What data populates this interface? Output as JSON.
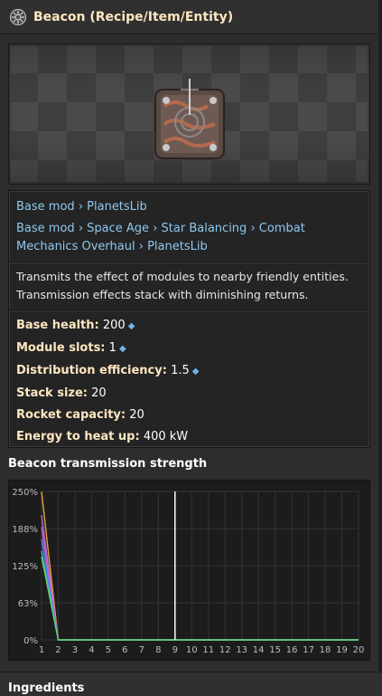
{
  "header": {
    "title": "Beacon (Recipe/Item/Entity)",
    "icon": "gear-icon"
  },
  "breadcrumbs": {
    "line1": [
      "Base mod",
      "PlanetsLib"
    ],
    "line2": [
      "Base mod",
      "Space Age",
      "Star Balancing",
      "Combat Mechanics Overhaul",
      "PlanetsLib"
    ],
    "separator": "›"
  },
  "description": {
    "line1": "Transmits the effect of modules to nearby friendly entities.",
    "line2": "Transmission effects stack with diminishing returns."
  },
  "stats": [
    {
      "key": "Base health:",
      "value": "200",
      "diamond": true
    },
    {
      "key": "Module slots:",
      "value": "1",
      "diamond": true
    },
    {
      "key": "Distribution efficiency:",
      "value": "1.5",
      "diamond": true
    },
    {
      "key": "Stack size:",
      "value": "20",
      "diamond": false
    },
    {
      "key": "Rocket capacity:",
      "value": "20",
      "diamond": false
    },
    {
      "key": "Energy to heat up:",
      "value": "400 kW",
      "diamond": false
    }
  ],
  "chart_section": {
    "heading": "Beacon transmission strength"
  },
  "ingredients": {
    "heading": "Ingredients"
  },
  "colors": {
    "link": "#8ec8f0",
    "label": "#ffe6c0",
    "main_line": "#e6a23c",
    "marker": "#ffffff"
  },
  "chart_data": {
    "type": "line",
    "title": "Beacon transmission strength",
    "x": [
      1,
      2,
      3,
      4,
      5,
      6,
      7,
      8,
      9,
      10,
      11,
      12,
      13,
      14,
      15,
      16,
      17,
      18,
      19,
      20
    ],
    "xticks": [
      "1",
      "2",
      "3",
      "4",
      "5",
      "6",
      "7",
      "8",
      "9",
      "10",
      "11",
      "12",
      "13",
      "14",
      "15",
      "16",
      "17",
      "18",
      "19",
      "20"
    ],
    "yticks": [
      "0%",
      "63%",
      "125%",
      "188%",
      "250%"
    ],
    "ylim": [
      0,
      250
    ],
    "xlim": [
      1,
      20
    ],
    "grid": true,
    "marker_x": 9,
    "series": [
      {
        "color": "#e6a23c",
        "values": [
          250,
          0,
          0,
          0,
          0,
          0,
          0,
          0,
          0,
          0,
          0,
          0,
          0,
          0,
          0,
          0,
          0,
          0,
          0,
          0
        ]
      },
      {
        "color": "#b070e0",
        "values": [
          210,
          0,
          0,
          0,
          0,
          0,
          0,
          0,
          0,
          0,
          0,
          0,
          0,
          0,
          0,
          0,
          0,
          0,
          0,
          0
        ]
      },
      {
        "color": "#d060c0",
        "values": [
          190,
          0,
          0,
          0,
          0,
          0,
          0,
          0,
          0,
          0,
          0,
          0,
          0,
          0,
          0,
          0,
          0,
          0,
          0,
          0
        ]
      },
      {
        "color": "#6080ff",
        "values": [
          170,
          0,
          0,
          0,
          0,
          0,
          0,
          0,
          0,
          0,
          0,
          0,
          0,
          0,
          0,
          0,
          0,
          0,
          0,
          0
        ]
      },
      {
        "color": "#40c0c0",
        "values": [
          150,
          0,
          0,
          0,
          0,
          0,
          0,
          0,
          0,
          0,
          0,
          0,
          0,
          0,
          0,
          0,
          0,
          0,
          0,
          0
        ]
      },
      {
        "color": "#60d060",
        "values": [
          140,
          0,
          0,
          0,
          0,
          0,
          0,
          0,
          0,
          0,
          0,
          0,
          0,
          0,
          0,
          0,
          0,
          0,
          0,
          0
        ]
      }
    ]
  }
}
